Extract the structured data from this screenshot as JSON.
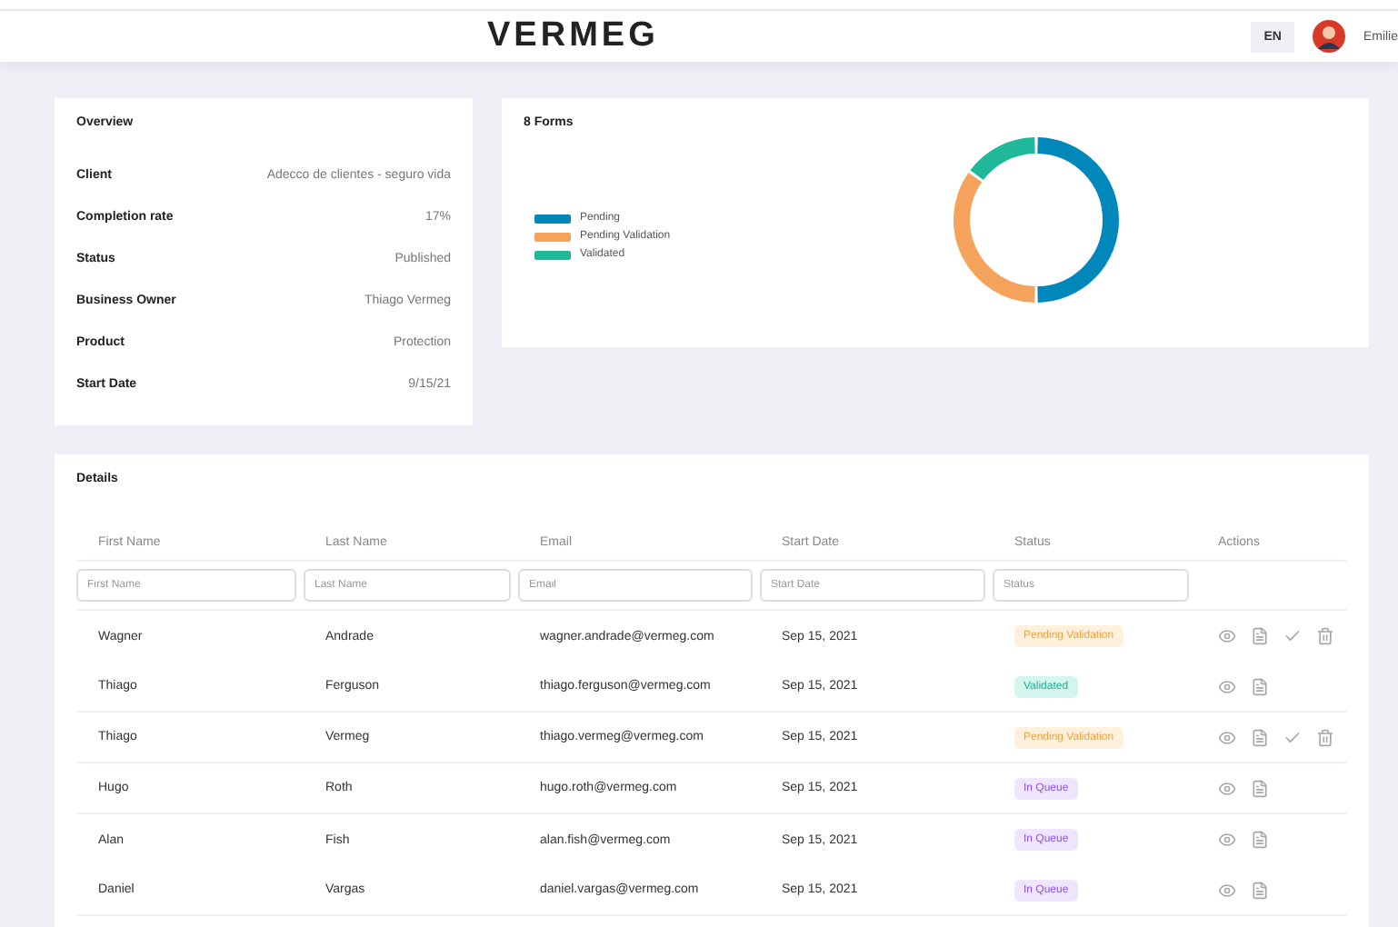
{
  "header": {
    "logo": "VERMEG",
    "language": "EN",
    "user": "Emilie"
  },
  "overview": {
    "title": "Overview",
    "fields": [
      {
        "label": "Client",
        "value": "Adecco de clientes - seguro vida"
      },
      {
        "label": "Completion rate",
        "value": "17%"
      },
      {
        "label": "Status",
        "value": "Published"
      },
      {
        "label": "Business Owner",
        "value": "Thiago Vermeg"
      },
      {
        "label": "Product",
        "value": "Protection"
      },
      {
        "label": "Start Date",
        "value": "9/15/21"
      }
    ]
  },
  "forms": {
    "title": "8 Forms",
    "legend": [
      {
        "label": "Pending",
        "color": "#0088bb"
      },
      {
        "label": "Pending Validation",
        "color": "#f5a35c"
      },
      {
        "label": "Validated",
        "color": "#1fb89a"
      }
    ]
  },
  "details": {
    "title": "Details",
    "columns": [
      "First Name",
      "Last Name",
      "Email",
      "Start Date",
      "Status",
      "Actions"
    ],
    "filters": [
      {
        "placeholder": "First Name"
      },
      {
        "placeholder": "Last Name"
      },
      {
        "placeholder": "Email"
      },
      {
        "placeholder": "Start Date"
      },
      {
        "placeholder": "Status"
      }
    ],
    "rows": [
      {
        "first": "Wagner",
        "last": "Andrade",
        "email": "wagner.andrade@vermeg.com",
        "date": "Sep 15, 2021",
        "status": {
          "label": "Pending Validation",
          "kind": "pending"
        },
        "validatable": true
      },
      {
        "first": "Thiago",
        "last": "Ferguson",
        "email": "thiago.ferguson@vermeg.com",
        "date": "Sep 15, 2021",
        "status": {
          "label": "Validated",
          "kind": "validated"
        },
        "validatable": false
      },
      {
        "first": "Thiago",
        "last": "Vermeg",
        "email": "thiago.vermeg@vermeg.com",
        "date": "Sep 15, 2021",
        "status": {
          "label": "Pending Validation",
          "kind": "pending"
        },
        "validatable": true
      },
      {
        "first": "Hugo",
        "last": "Roth",
        "email": "hugo.roth@vermeg.com",
        "date": "Sep 15, 2021",
        "status": {
          "label": "In Queue",
          "kind": "queue"
        },
        "validatable": false
      },
      {
        "first": "Alan",
        "last": "Fish",
        "email": "alan.fish@vermeg.com",
        "date": "Sep 15, 2021",
        "status": {
          "label": "In Queue",
          "kind": "queue"
        },
        "validatable": false
      },
      {
        "first": "Daniel",
        "last": "Vargas",
        "email": "daniel.vargas@vermeg.com",
        "date": "Sep 15, 2021",
        "status": {
          "label": "In Queue",
          "kind": "queue"
        },
        "validatable": false
      }
    ]
  }
}
